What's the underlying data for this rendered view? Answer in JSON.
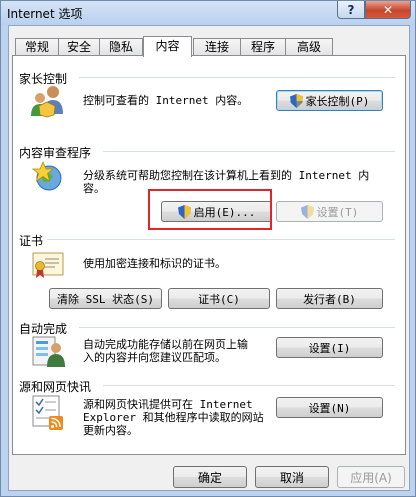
{
  "window": {
    "title": "Internet 选项",
    "help_label": "?",
    "close_label": "✕"
  },
  "tabs": [
    {
      "label": "常规"
    },
    {
      "label": "安全"
    },
    {
      "label": "隐私"
    },
    {
      "label": "内容"
    },
    {
      "label": "连接"
    },
    {
      "label": "程序"
    },
    {
      "label": "高级"
    }
  ],
  "active_tab": "内容",
  "parental": {
    "heading": "家长控制",
    "description": "控制可查看的 Internet 内容。",
    "button": "家长控制(P)"
  },
  "advisor": {
    "heading": "内容审查程序",
    "description_line1": "分级系统可帮助您控制在该计算机上看到的 Internet 内",
    "description_line2": "容。",
    "enable_button": "启用(E)...",
    "settings_button": "设置(T)"
  },
  "certificates": {
    "heading": "证书",
    "description": "使用加密连接和标识的证书。",
    "clear_ssl_button": "清除 SSL 状态(S)",
    "certificates_button": "证书(C)",
    "publishers_button": "发行者(B)"
  },
  "autocomplete": {
    "heading": "自动完成",
    "description_line1": "自动完成功能存储以前在网页上输",
    "description_line2": "入的内容并向您建议匹配项。",
    "settings_button": "设置(I)"
  },
  "feeds": {
    "heading": "源和网页快讯",
    "description_line1": "源和网页快讯提供可在 Internet",
    "description_line2": "Explorer 和其他程序中读取的网站",
    "description_line3": "更新内容。",
    "settings_button": "设置(N)"
  },
  "footer": {
    "ok": "确定",
    "cancel": "取消",
    "apply": "应用(A)"
  },
  "colors": {
    "highlight": "#e0262b",
    "title_bar": "#bcd2ee",
    "close_button": "#c8452c"
  }
}
